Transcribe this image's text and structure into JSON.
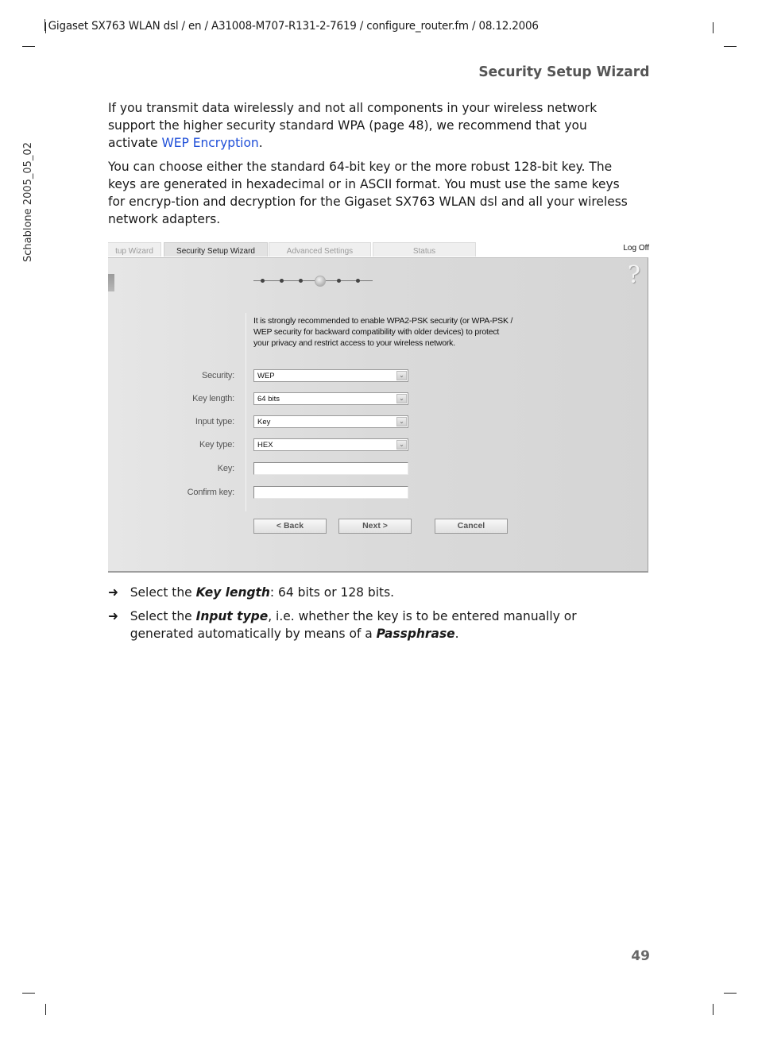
{
  "header": {
    "running_header": "Gigaset SX763 WLAN dsl / en / A31008-M707-R131-2-7619 / configure_router.fm / 08.12.2006",
    "section_title": "Security Setup Wizard",
    "side_label": "Schablone 2005_05_02"
  },
  "body": {
    "paragraph1_text": "If you transmit data wirelessly and not all components in your wireless network support the higher security standard WPA (page 48), we recommend that you activate ",
    "paragraph1_link": "WEP Encryption",
    "paragraph1_end": ".",
    "paragraph2": "You can choose either the standard 64-bit key or the more robust 128-bit key. The keys are generated in hexadecimal or in ASCII format. You must use the same keys for encryp-tion and decryption for the Gigaset SX763 WLAN dsl and all your wireless network adapters."
  },
  "screenshot": {
    "tabs": [
      {
        "label": "tup Wizard",
        "active": false
      },
      {
        "label": "Security Setup Wizard",
        "active": true
      },
      {
        "label": "Advanced Settings",
        "active": false
      },
      {
        "label": "Status",
        "active": false
      }
    ],
    "logoff_label": "Log Off",
    "help_icon": "?",
    "wizard_steps": {
      "total": 6,
      "current": 4
    },
    "notice": "It is strongly recommended to enable WPA2-PSK security (or WPA-PSK / WEP security for backward compatibility with older devices) to protect your privacy and restrict access to your wireless network.",
    "fields": [
      {
        "label": "Security:",
        "type": "select",
        "value": "WEP"
      },
      {
        "label": "Key length:",
        "type": "select",
        "value": "64 bits"
      },
      {
        "label": "Input type:",
        "type": "select",
        "value": "Key"
      },
      {
        "label": "Key type:",
        "type": "select",
        "value": "HEX"
      },
      {
        "label": "Key:",
        "type": "text",
        "value": ""
      },
      {
        "label": "Confirm key:",
        "type": "text",
        "value": ""
      }
    ],
    "buttons": {
      "back": "< Back",
      "next": "Next >",
      "cancel": "Cancel"
    }
  },
  "instructions": [
    {
      "pre": "Select the ",
      "bold": "Key length",
      "post": ": 64 bits or 128 bits."
    },
    {
      "pre": "Select the ",
      "bold": "Input type",
      "post": ", i.e. whether the key is to be entered manually or generated automatically by means of a ",
      "bold2": "Passphrase",
      "post2": "."
    }
  ],
  "arrow_icon": "➜",
  "page_number": "49"
}
